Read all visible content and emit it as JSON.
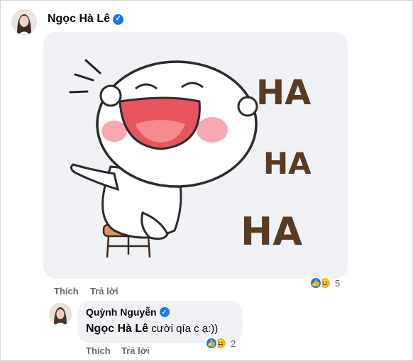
{
  "post": {
    "author": "Ngọc Hà Lê",
    "sticker_text": [
      "HA",
      "HA",
      "HA"
    ],
    "actions": {
      "like": "Thích",
      "reply": "Trả lời"
    },
    "reactions": {
      "count": "5"
    }
  },
  "reply": {
    "author": "Quỳnh Nguyễn",
    "mention": "Ngọc Hà Lê",
    "text": "cười qía c ạ:))",
    "actions": {
      "like": "Thích",
      "reply": "Trả lời"
    },
    "reactions": {
      "count": "2"
    }
  },
  "colors": {
    "verified": "#1877f2",
    "bubble": "#f0f2f5",
    "sticker_text": "#5b3a22",
    "blush": "#f7a8b0",
    "mouth": "#e9545d"
  },
  "icons": [
    "verified-badge-icon",
    "like-reaction-icon",
    "haha-reaction-icon"
  ]
}
